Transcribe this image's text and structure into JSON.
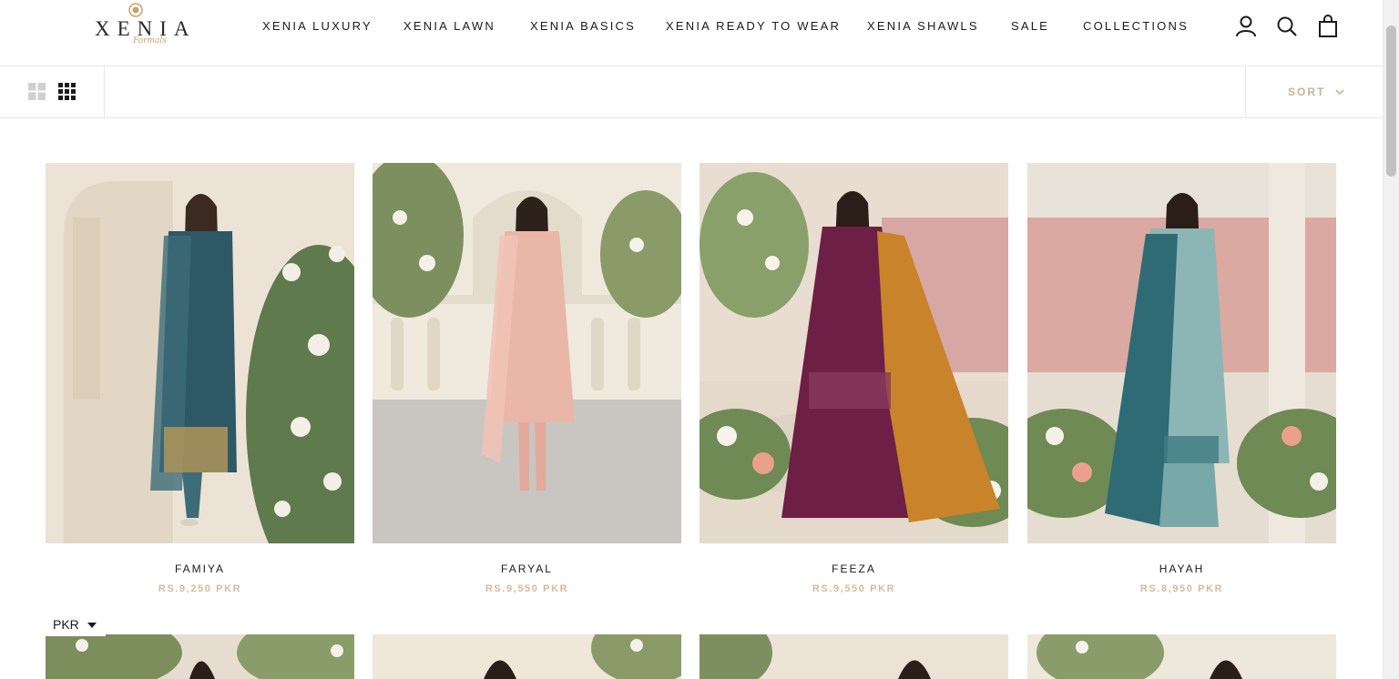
{
  "brand": {
    "name": "XENIA",
    "script": "Formals"
  },
  "nav": {
    "items": [
      {
        "label": "XENIA LUXURY"
      },
      {
        "label": "XENIA LAWN"
      },
      {
        "label": "XENIA BASICS"
      },
      {
        "label": "XENIA READY TO WEAR"
      },
      {
        "label": "XENIA SHAWLS"
      },
      {
        "label": "SALE"
      },
      {
        "label": "COLLECTIONS"
      }
    ],
    "icons": [
      "account-icon",
      "search-icon",
      "cart-icon"
    ]
  },
  "toolbar": {
    "layout_options": [
      "grid-2-icon",
      "grid-4-icon"
    ],
    "sort_label": "SORT"
  },
  "products": [
    {
      "title": "FAMIYA",
      "price": "RS.9,250 PKR",
      "dress": "#2f5866",
      "accent": "#b89a5a",
      "bg": "#ece3d6"
    },
    {
      "title": "FARYAL",
      "price": "RS.9,550 PKR",
      "dress": "#e9b6a8",
      "accent": "#d99a8c",
      "bg": "#efe8dc"
    },
    {
      "title": "FEEZA",
      "price": "RS.9,550 PKR",
      "dress": "#6e1f45",
      "accent": "#c9832a",
      "bg": "#e8ddd0"
    },
    {
      "title": "HAYAH",
      "price": "RS.8,950 PKR",
      "dress": "#8cb6b6",
      "accent": "#2f6b74",
      "bg": "#dcc3bd"
    }
  ],
  "currency": {
    "selected": "PKR"
  },
  "colors": {
    "price": "#d9b99a",
    "text": "#1c1b1b",
    "border": "#e6e6e6",
    "gold": "#c9a16a"
  }
}
